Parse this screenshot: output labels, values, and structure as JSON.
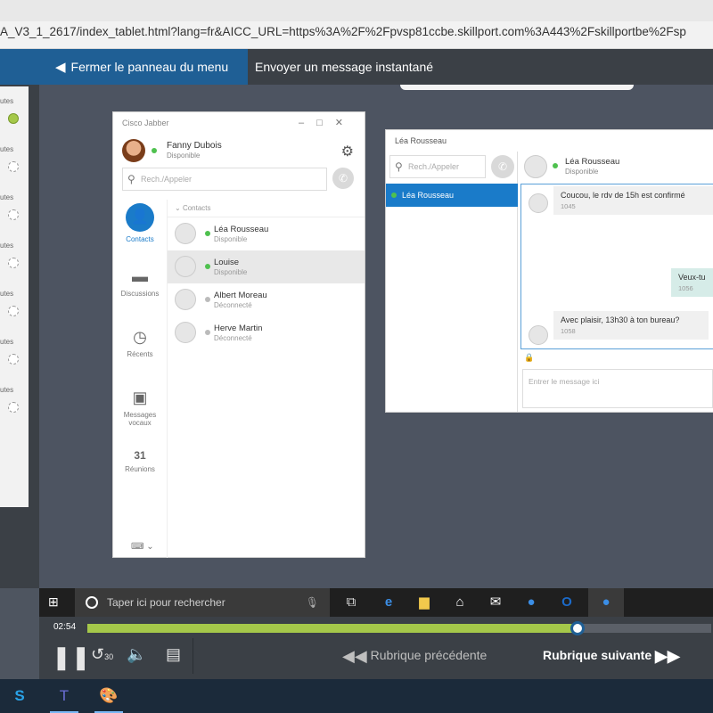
{
  "browser": {
    "url": "A_V3_1_2617/index_tablet.html?lang=fr&AICC_URL=https%3A%2F%2Fpvsp81ccbe.skillport.com%3A443%2Fskillportbe%2Fsp"
  },
  "course_header": {
    "menu_toggle_label": "Fermer le panneau du menu",
    "lesson_title": "Envoyer un message instantané"
  },
  "left_panel": {
    "items": [
      {
        "label": "utes",
        "status": "done"
      },
      {
        "label": "utes",
        "status": "todo"
      },
      {
        "label": "utes",
        "status": "todo"
      },
      {
        "label": "utes",
        "status": "todo"
      },
      {
        "label": "utes",
        "status": "todo"
      },
      {
        "label": "utes",
        "status": "todo"
      },
      {
        "label": "utes",
        "status": "todo"
      }
    ]
  },
  "jabber": {
    "window_title": "Cisco Jabber",
    "user": {
      "name": "Fanny Dubois",
      "status": "Disponible"
    },
    "search_placeholder": "Rech./Appeler",
    "nav": [
      {
        "label": "Contacts",
        "icon": "contacts-icon",
        "active": true
      },
      {
        "label": "Discussions",
        "icon": "chat-icon",
        "active": false
      },
      {
        "label": "Récents",
        "icon": "clock-icon",
        "active": false
      },
      {
        "label": "Messages vocaux",
        "icon": "voicemail-icon",
        "active": false
      },
      {
        "label": "Réunions",
        "icon": "calendar-icon",
        "active": false
      }
    ],
    "calendar_day": "31",
    "contacts_header": "Contacts",
    "contacts": [
      {
        "name": "Léa Rousseau",
        "status": "Disponible",
        "online": true,
        "selected": false
      },
      {
        "name": "Louise",
        "status": "Disponible",
        "online": true,
        "selected": true
      },
      {
        "name": "Albert Moreau",
        "status": "Déconnecté",
        "online": false,
        "selected": false
      },
      {
        "name": "Herve Martin",
        "status": "Déconnecté",
        "online": false,
        "selected": false
      }
    ]
  },
  "chat": {
    "window_title": "Léa Rousseau",
    "search_placeholder": "Rech./Appeler",
    "conversation_item": "Léa Rousseau",
    "contact": {
      "name": "Léa Rousseau",
      "status": "Disponible"
    },
    "messages": [
      {
        "text": "Coucou, le rdv de 15h est confirmé",
        "time": "1045",
        "direction": "in"
      },
      {
        "text": "Veux-tu",
        "time": "1056",
        "direction": "out"
      },
      {
        "text": "Avec plaisir, 13h30 à ton bureau?",
        "time": "1058",
        "direction": "in"
      }
    ],
    "input_placeholder": "Entrer le message ici"
  },
  "taskbar": {
    "search_placeholder": "Taper ici pour rechercher"
  },
  "player": {
    "time": "02:54",
    "progress": 0.785,
    "prev_label": "Rubrique précédente",
    "next_label": "Rubrique suivante",
    "replay_seconds": "30"
  },
  "colors": {
    "accent_blue": "#1a7bc9",
    "progress_green": "#a5c84a",
    "online_green": "#4fc14f"
  }
}
